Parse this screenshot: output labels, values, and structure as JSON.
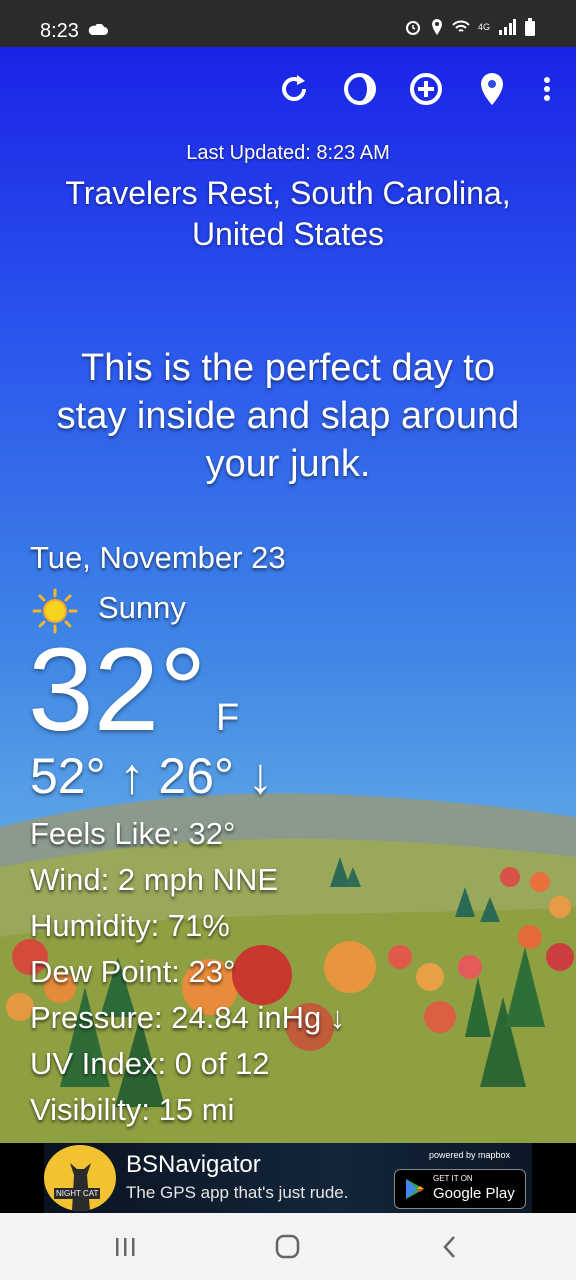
{
  "status_bar": {
    "time": "8:23",
    "network": "4G"
  },
  "toolbar": {
    "refresh_icon": "refresh-icon",
    "theme_icon": "theme-icon",
    "add_icon": "add-location-icon",
    "location_icon": "location-pin-icon",
    "menu_icon": "more-vert-icon"
  },
  "header": {
    "last_updated": "Last Updated: 8:23 AM",
    "location_line1": "Travelers Rest, South Carolina,",
    "location_line2": "United States"
  },
  "tagline": {
    "line1": "This is the perfect day to",
    "line2": "stay inside and slap around",
    "line3": "your junk."
  },
  "weather": {
    "date": "Tue, November 23",
    "condition": "Sunny",
    "condition_icon": "sun-icon",
    "temperature": "32°",
    "unit": "F",
    "high_low": "52° ↑ 26° ↓",
    "details": [
      "Feels Like:  32°",
      "Wind:  2 mph NNE",
      "Humidity:  71%",
      "Dew Point:  23°",
      "Pressure:  24.84 inHg ↓",
      "UV Index:  0 of 12",
      "Visibility:  15 mi"
    ]
  },
  "ad": {
    "logo_text": "NIGHT CAT",
    "title": "BSNavigator",
    "subtitle": "The GPS app that's just rude.",
    "powered_by": "powered by mapbox",
    "store_getit": "GET IT ON",
    "store_name": "Google Play"
  },
  "colors": {
    "sky_top": "#1a23e6",
    "sky_bottom": "#7bbbe8",
    "accent_sun": "#f2c230"
  }
}
